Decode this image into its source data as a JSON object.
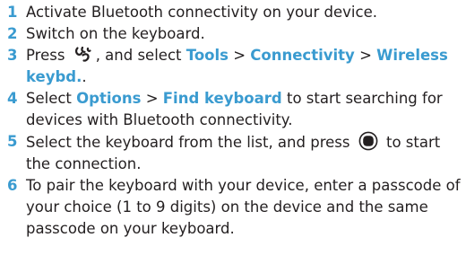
{
  "colors": {
    "accent": "#3a9bd0",
    "text": "#231f20"
  },
  "steps": [
    {
      "num": "1",
      "text": "Activate Bluetooth connectivity on your device."
    },
    {
      "num": "2",
      "text": "Switch on the keyboard."
    },
    {
      "num": "3",
      "pre": "Press",
      "icon": "menu-key-icon",
      "mid": ", and select",
      "menu_1": "Tools",
      "sep_1": ">",
      "menu_2": "Connectivity",
      "sep_2": ">",
      "menu_3": "Wireless keybd.",
      "end": "."
    },
    {
      "num": "4",
      "pre": "Select",
      "menu_1": "Options",
      "sep_1": ">",
      "menu_2": "Find keyboard",
      "post": "to start searching for devices with Bluetooth connectivity."
    },
    {
      "num": "5",
      "pre": "Select the keyboard from the list, and press",
      "icon": "select-key-icon",
      "post": "to start the connection."
    },
    {
      "num": "6",
      "text": "To pair the keyboard with your device, enter a passcode of your choice (1 to 9 digits) on the device and the same passcode on your keyboard."
    }
  ]
}
